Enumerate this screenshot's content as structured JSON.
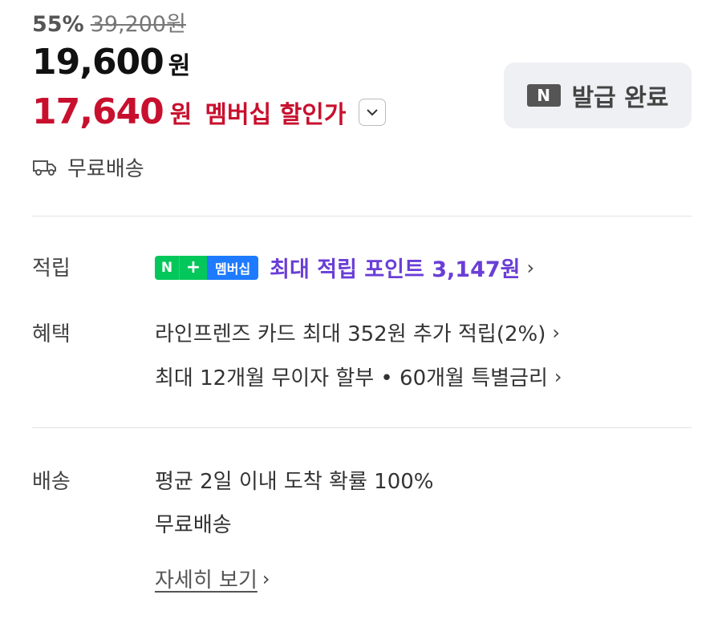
{
  "price": {
    "discount_rate": "55%",
    "original_price": "39,200원",
    "sale_price": "19,600",
    "sale_unit": "원",
    "member_price": "17,640",
    "member_unit": "원",
    "member_label": "멤버십 할인가"
  },
  "coupon": {
    "badge": "N",
    "label": "발급 완료"
  },
  "shipping_summary": "무료배송",
  "rows": {
    "points": {
      "label": "적립",
      "badge_n": "N",
      "badge_plus": "+",
      "badge_membership": "멤버십",
      "text": "최대 적립 포인트 3,147원"
    },
    "benefits": {
      "label": "혜택",
      "items": [
        "라인프렌즈 카드 최대 352원 추가 적립(2%)",
        "최대 12개월 무이자 할부 • 60개월 특별금리"
      ]
    },
    "delivery": {
      "label": "배송",
      "line1": "평균 2일 이내 도착 확률 100%",
      "line2": "무료배송",
      "more": "자세히 보기"
    }
  },
  "colors": {
    "member_red": "#c8102e",
    "point_purple": "#6a3ed6",
    "naver_green": "#03c75a",
    "membership_blue": "#1e7bff"
  },
  "icons": [
    "chevron-down-icon",
    "truck-icon",
    "chevron-right-icon"
  ]
}
